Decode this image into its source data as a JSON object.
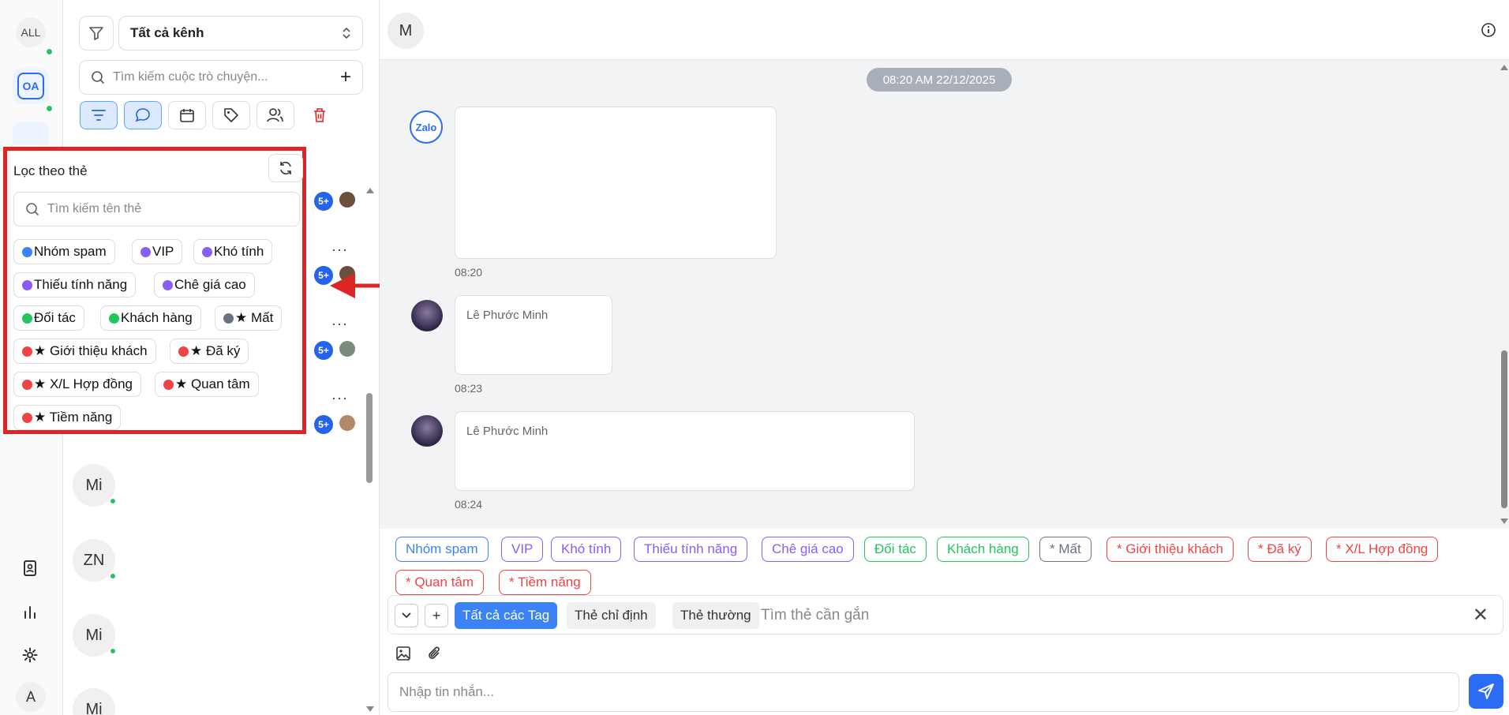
{
  "rail": {
    "all_label": "ALL",
    "oa_label": "OA",
    "avatar_label": "A"
  },
  "panel": {
    "channel": "Tất cả kênh",
    "search_placeholder": "Tìm kiếm cuộc trò chuyện...",
    "badge": "5+",
    "conversations": [
      {
        "initials": "Mi"
      },
      {
        "initials": "ZN"
      },
      {
        "initials": "Mi"
      },
      {
        "initials": "Mi"
      }
    ]
  },
  "popup": {
    "title": "Lọc theo thẻ",
    "search_placeholder": "Tìm kiếm tên thẻ",
    "tags": [
      {
        "label": "Nhóm spam",
        "color": "#3b82f6"
      },
      {
        "label": "VIP",
        "color": "#8b5cf6"
      },
      {
        "label": "Khó tính",
        "color": "#8b5cf6"
      },
      {
        "label": "Thiếu tính năng",
        "color": "#8b5cf6"
      },
      {
        "label": "Chê giá cao",
        "color": "#8b5cf6"
      },
      {
        "label": "Đối tác",
        "color": "#22c55e"
      },
      {
        "label": "Khách hàng",
        "color": "#22c55e"
      },
      {
        "label": "★ Mất",
        "color": "#6b7280"
      },
      {
        "label": "★ Giới thiệu khách",
        "color": "#ef4444"
      },
      {
        "label": "★ Đã ký",
        "color": "#ef4444"
      },
      {
        "label": "★ X/L Hợp đồng",
        "color": "#ef4444"
      },
      {
        "label": "★ Quan tâm",
        "color": "#ef4444"
      },
      {
        "label": "★ Tiềm năng",
        "color": "#ef4444"
      }
    ]
  },
  "chat": {
    "header_initial": "M",
    "date": "08:20 AM 22/12/2025",
    "zalo_label": "Zalo",
    "messages": [
      {
        "time": "08:20",
        "sender": ""
      },
      {
        "time": "08:23",
        "sender": "Lê Phước Minh"
      },
      {
        "time": "08:24",
        "sender": "Lê Phước Minh"
      }
    ]
  },
  "tagbar": {
    "tags": [
      {
        "label": "Nhóm spam",
        "color": "#3b82f6"
      },
      {
        "label": "VIP",
        "color": "#8b5cf6"
      },
      {
        "label": "Khó tính",
        "color": "#8b5cf6"
      },
      {
        "label": "Thiếu tính năng",
        "color": "#8b5cf6"
      },
      {
        "label": "Chê giá cao",
        "color": "#8b5cf6"
      },
      {
        "label": "Đối tác",
        "color": "#22c55e"
      },
      {
        "label": "Khách hàng",
        "color": "#22c55e"
      },
      {
        "label": "* Mất",
        "color": "#6b7280"
      },
      {
        "label": "* Giới thiệu khách",
        "color": "#ef4444"
      },
      {
        "label": "* Đã ký",
        "color": "#ef4444"
      },
      {
        "label": "* X/L Hợp đồng",
        "color": "#ef4444"
      },
      {
        "label": "* Quan tâm",
        "color": "#ef4444"
      },
      {
        "label": "* Tiềm năng",
        "color": "#ef4444"
      }
    ],
    "tab_all": "Tất cả các Tag",
    "tab_specified": "Thẻ chỉ định",
    "tab_normal": "Thẻ thường",
    "find_placeholder": "Tìm thẻ cần gắn",
    "message_placeholder": "Nhập tin nhắn..."
  }
}
